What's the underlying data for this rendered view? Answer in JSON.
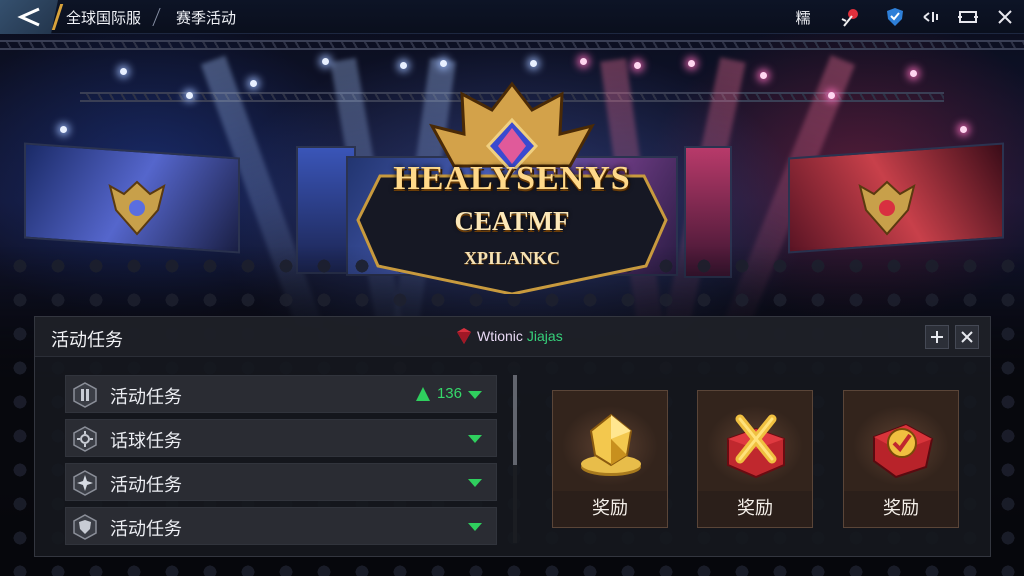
{
  "header": {
    "breadcrumb": [
      "全球国际服",
      "赛季活动"
    ],
    "right_icons": [
      "menu-text-icon",
      "rose-icon",
      "shield-badge-icon",
      "sound-icon",
      "fullscreen-icon",
      "close-icon"
    ],
    "menu_text": "糯"
  },
  "logo": {
    "line1": "HEALYSENYS",
    "line2": "CEATMF",
    "line3": "XPILANKC"
  },
  "panel": {
    "title": "活动任务",
    "subtitle_part1": "Wtionic",
    "subtitle_part2": "Jiajas",
    "buttons": [
      "add-icon",
      "close-icon"
    ]
  },
  "tasks": [
    {
      "label": "活动任务",
      "icon": "tower-icon",
      "count": "136",
      "has_up_arrow": true
    },
    {
      "label": "话球任务",
      "icon": "gear-icon"
    },
    {
      "label": "活动任务",
      "icon": "star-burst-icon"
    },
    {
      "label": "活动任务",
      "icon": "shield-icon"
    }
  ],
  "rewards": [
    {
      "label": "奖励",
      "icon": "gold-crystal-icon"
    },
    {
      "label": "奖励",
      "icon": "gift-box-icon"
    },
    {
      "label": "奖励",
      "icon": "red-chest-icon"
    }
  ],
  "colors": {
    "accent_green": "#36d86a",
    "gold": "#d7a23b",
    "panel_bg": "#16181e"
  }
}
